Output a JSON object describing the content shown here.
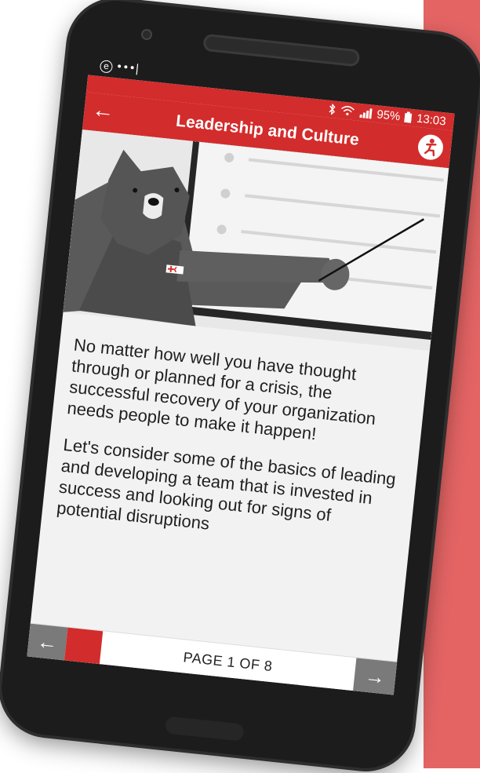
{
  "status_bar": {
    "notification_icon": "e",
    "notification_dots": "•••|",
    "battery_percent": "95%",
    "time": "13:03",
    "icons": [
      "bluetooth-icon",
      "wifi-icon",
      "signal-icon",
      "battery-icon"
    ]
  },
  "app_bar": {
    "title": "Leadership and Culture",
    "back_icon": "←",
    "accessibility_icon": "accessibility-icon"
  },
  "content": {
    "paragraphs": [
      "No matter how well you have thought through or planned for a crisis, the successful recovery of your organization needs people to make it happen!",
      "Let's consider some of the basics of leading and developing a team that is invested in success and looking out for signs of potential disruptions"
    ]
  },
  "pager": {
    "label": "PAGE 1 OF 8",
    "prev_icon": "←",
    "next_icon": "→",
    "progress": 0.125
  },
  "colors": {
    "brand_red": "#d32c2c",
    "deco_red": "#e46464"
  }
}
